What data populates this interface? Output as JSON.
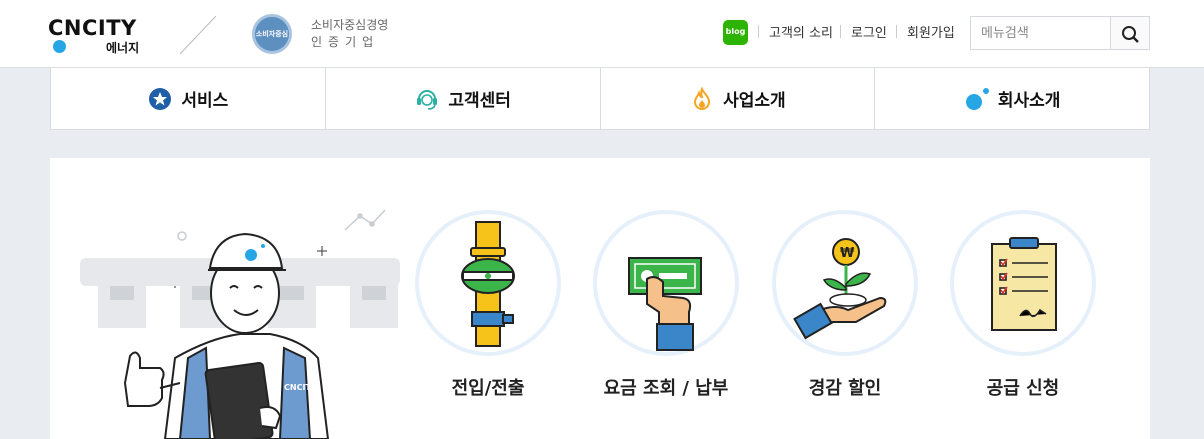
{
  "header": {
    "logo_text": "CNCITY",
    "logo_sub": "에너지",
    "cert_badge": "소비자중심",
    "cert_line1": "소비자중심경영",
    "cert_line2": "인증기업",
    "blog_icon": "blog",
    "links": [
      "고객의 소리",
      "로그인",
      "회원가입"
    ],
    "search_placeholder": "메뉴검색"
  },
  "nav": {
    "items": [
      {
        "label": "서비스",
        "icon": "star-badge-icon",
        "color": "#1f5fa8"
      },
      {
        "label": "고객센터",
        "icon": "headset-icon",
        "color": "#2bb0a4"
      },
      {
        "label": "사업소개",
        "icon": "flame-icon",
        "color": "#f5a623"
      },
      {
        "label": "회사소개",
        "icon": "orbit-dot-icon",
        "color": "#27a6e6"
      }
    ]
  },
  "main": {
    "mascot_badge": "CNCITY",
    "services": [
      {
        "label": "전입/전출",
        "icon": "gas-pipe-icon"
      },
      {
        "label": "요금 조회 / 납부",
        "icon": "hand-money-icon"
      },
      {
        "label": "경감 할인",
        "icon": "plant-coin-icon"
      },
      {
        "label": "공급 신청",
        "icon": "clipboard-icon"
      }
    ]
  },
  "colors": {
    "accent_blue": "#27a6e6",
    "circle_border": "#e6f0fb",
    "background": "#e9ecf0"
  }
}
